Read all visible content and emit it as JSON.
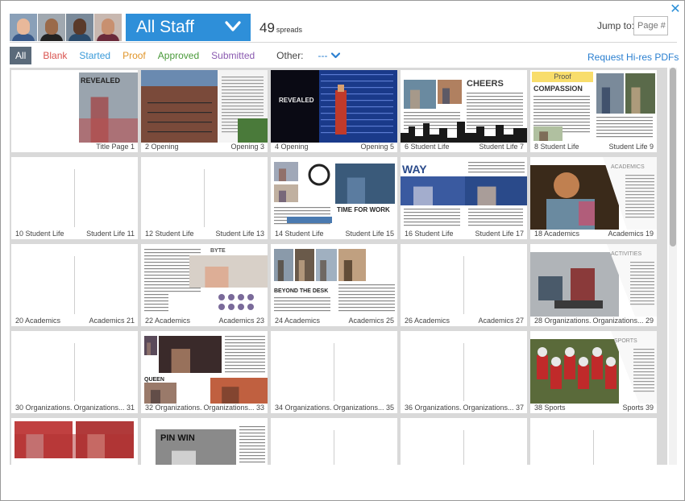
{
  "header": {
    "staff_label": "All Staff",
    "spread_count": "49",
    "spread_unit": "spreads",
    "jump_label": "Jump to:",
    "jump_placeholder": "Page #",
    "close_icon": "close-icon"
  },
  "avatars": [
    {
      "name": "avatar-1",
      "skin": "#e8b89a",
      "shirt": "#3a5a8a"
    },
    {
      "name": "avatar-2",
      "skin": "#9a6a4a",
      "shirt": "#222222"
    },
    {
      "name": "avatar-3",
      "skin": "#5a3a2a",
      "shirt": "#2a4a6a"
    },
    {
      "name": "avatar-4",
      "skin": "#c89070",
      "shirt": "#6a2a3a"
    }
  ],
  "filters": {
    "items": [
      {
        "label": "All",
        "color": "#ffffff",
        "active": true
      },
      {
        "label": "Blank",
        "color": "#d9534f"
      },
      {
        "label": "Started",
        "color": "#3a9ad9"
      },
      {
        "label": "Proof",
        "color": "#e0952a"
      },
      {
        "label": "Approved",
        "color": "#4a9a3a"
      },
      {
        "label": "Submitted",
        "color": "#8a5ab0"
      }
    ],
    "other_label": "Other:",
    "other_value": "---"
  },
  "hires_label": "Request Hi-res PDFs",
  "spreads": [
    {
      "left": "",
      "right": "Title Page  1",
      "art": "title"
    },
    {
      "left": "2  Opening",
      "right": "Opening  3",
      "art": "building"
    },
    {
      "left": "4  Opening",
      "right": "Opening  5",
      "art": "stage"
    },
    {
      "left": "6  Student Life",
      "right": "Student Life  7",
      "art": "cheers"
    },
    {
      "left": "8  Student Life",
      "right": "Student Life  9",
      "art": "compassion",
      "badge": "Proof"
    },
    {
      "left": "10  Student Life",
      "right": "Student Life  11",
      "art": "blank"
    },
    {
      "left": "12  Student Life",
      "right": "Student Life  13",
      "art": "blank"
    },
    {
      "left": "14  Student Life",
      "right": "Student Life  15",
      "art": "work"
    },
    {
      "left": "16  Student Life",
      "right": "Student Life  17",
      "art": "crowd"
    },
    {
      "left": "18  Academics",
      "right": "Academics  19",
      "art": "lab"
    },
    {
      "left": "20  Academics",
      "right": "Academics  21",
      "art": "blank"
    },
    {
      "left": "22  Academics",
      "right": "Academics  23",
      "art": "byte"
    },
    {
      "left": "24  Academics",
      "right": "Academics  25",
      "art": "desk"
    },
    {
      "left": "26  Academics",
      "right": "Academics  27",
      "art": "blank"
    },
    {
      "left": "28  Organizations...",
      "right": "Organizations...  29",
      "art": "activities"
    },
    {
      "left": "30  Organizations...",
      "right": "Organizations...  31",
      "art": "blank"
    },
    {
      "left": "32  Organizations...",
      "right": "Organizations...  33",
      "art": "queen"
    },
    {
      "left": "34  Organizations...",
      "right": "Organizations...  35",
      "art": "blank"
    },
    {
      "left": "36  Organizations...",
      "right": "Organizations...  37",
      "art": "blank"
    },
    {
      "left": "38  Sports",
      "right": "Sports  39",
      "art": "sports"
    },
    {
      "left": "",
      "right": "",
      "art": "redcrowd"
    },
    {
      "left": "",
      "right": "",
      "art": "pinwin"
    },
    {
      "left": "",
      "right": "",
      "art": "blank"
    },
    {
      "left": "",
      "right": "",
      "art": "blank"
    },
    {
      "left": "",
      "right": "",
      "art": "blank"
    }
  ],
  "art_text": {
    "revealed": "REVEALED",
    "cheers": "CHEERS",
    "compassion": "COMPASSION",
    "work": "TIME FOR WORK",
    "way": "WAY",
    "academics": "ACADEMICS",
    "byte": "BYTE",
    "beyond": "BEYOND THE DESK",
    "activities": "ACTIVITIES",
    "queen": "QUEEN",
    "sports": "SPORTS",
    "pinwin": "PIN WIN"
  }
}
